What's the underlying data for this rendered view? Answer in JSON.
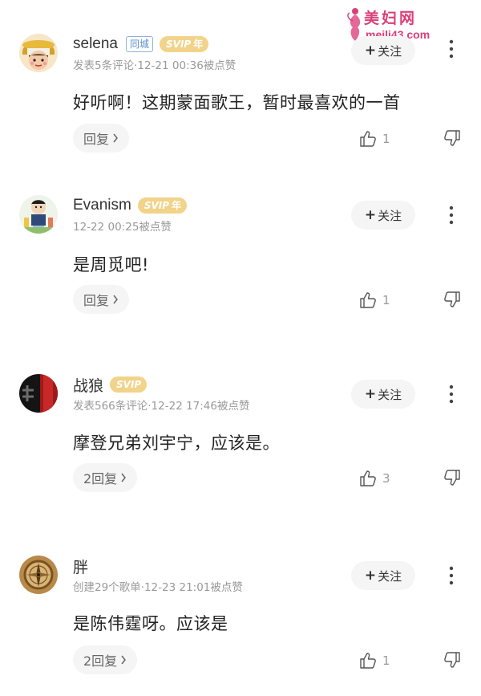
{
  "watermark": {
    "title": "美妇网",
    "url": "meili43.com"
  },
  "comments": [
    {
      "username": "selena",
      "city_tag": "同城",
      "svip_label": "SVIP",
      "svip_year": "年",
      "meta": "发表5条评论·12-21 00:36被点赞",
      "text": "好听啊！这期蒙面歌王，暂时最喜欢的一首",
      "reply": "回复",
      "likes": "1",
      "follow": "关注",
      "avatar": "cartoon-girl-avatar"
    },
    {
      "username": "Evanism",
      "svip_label": "SVIP",
      "svip_year": "年",
      "meta": "12-22 00:25被点赞",
      "text": "是周觅吧!",
      "reply": "回复",
      "likes": "1",
      "follow": "关注",
      "avatar": "cartoon-boy-avatar"
    },
    {
      "username": "战狼",
      "svip_label": "SVIP",
      "meta": "发表566条评论·12-22 17:46被点赞",
      "text": "摩登兄弟刘宇宁，应该是。",
      "reply": "2回复",
      "likes": "3",
      "follow": "关注",
      "avatar": "dark-red-avatar"
    },
    {
      "username": "胖",
      "meta": "创建29个歌单·12-23 21:01被点赞",
      "text": "是陈伟霆呀。应该是",
      "reply": "2回复",
      "likes": "1",
      "follow": "关注",
      "avatar": "compass-avatar"
    }
  ],
  "colors": {
    "svip": "#f2d38a",
    "city_tag": "#5b8ecf",
    "watermark": "#d9407a",
    "meta": "#999999"
  }
}
